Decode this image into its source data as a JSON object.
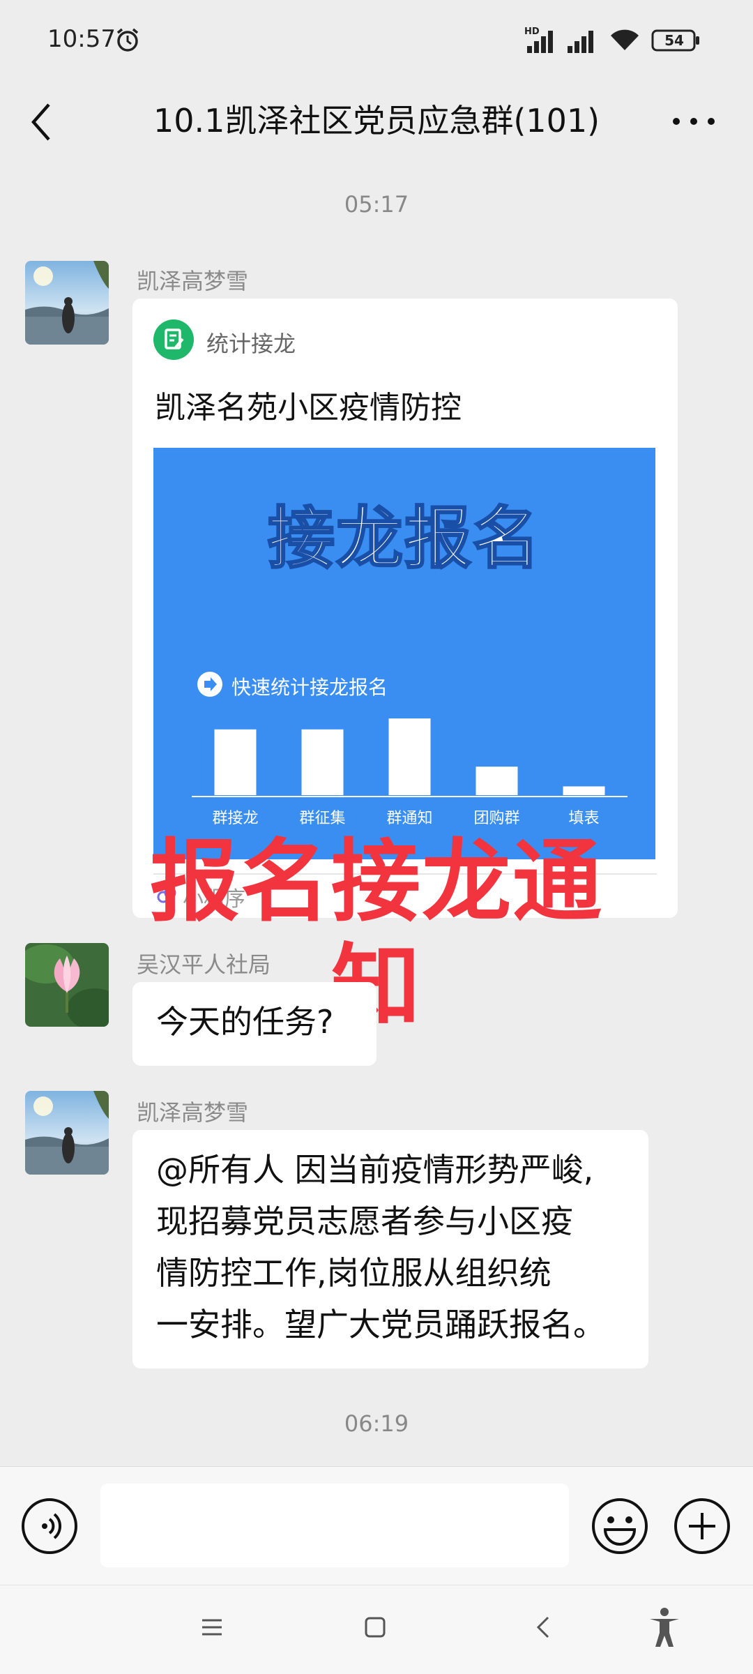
{
  "status_bar": {
    "time": "10:57",
    "network_label": "HD",
    "battery": "54"
  },
  "title_bar": {
    "title": "10.1凯泽社区党员应急群(101)"
  },
  "messages": {
    "timestamp_top": "05:17",
    "card_message": {
      "sender": "凯泽高梦雪",
      "app_name": "统计接龙",
      "title": "凯泽名苑小区疫情防控",
      "preview_heading": "接龙报名",
      "preview_subtitle": "快速统计接龙报名",
      "miniprogram_label": "小程序"
    },
    "overlay_caption": "报名接龙通知",
    "reply_message": {
      "sender": "吴汉平人社局",
      "text": "今天的任务?"
    },
    "notice_message": {
      "sender": "凯泽高梦雪",
      "lines": [
        "@所有人 因当前疫情形势严峻,",
        "现招募党员志愿者参与小区疫",
        "情防控工作,岗位服从组织统",
        "一安排。望广大党员踊跃报名。"
      ]
    },
    "timestamp_bottom": "06:19"
  },
  "preview_chart": {
    "categories": [
      "群接龙",
      "群征集",
      "群通知",
      "团购群",
      "填表"
    ],
    "values": [
      60,
      60,
      70,
      26,
      8
    ]
  },
  "input_bar": {
    "input_value": ""
  },
  "colors": {
    "background": "#ededed",
    "card_preview": "#3a8ef2",
    "overlay_caption": "#f2343f",
    "app_icon": "#1fb86a"
  }
}
